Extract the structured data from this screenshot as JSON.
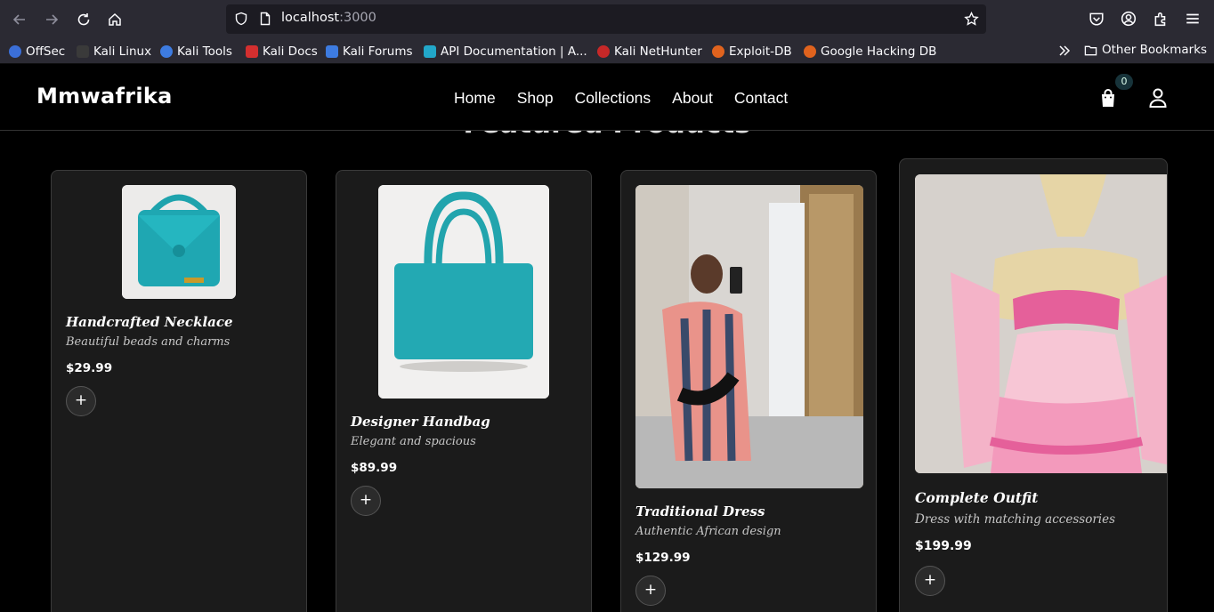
{
  "browser": {
    "url_host": "localhost",
    "url_port": ":3000",
    "bookmarks": [
      {
        "label": "OffSec",
        "color": "#3b6fd8"
      },
      {
        "label": "Kali Linux",
        "color": "#3a3a3a"
      },
      {
        "label": "Kali Tools",
        "color": "#3d7be0"
      },
      {
        "label": "Kali Docs",
        "color": "#d32f2f"
      },
      {
        "label": "Kali Forums",
        "color": "#3d7be0"
      },
      {
        "label": "API Documentation | A...",
        "color": "#22a7c9"
      },
      {
        "label": "Kali NetHunter",
        "color": "#c62828"
      },
      {
        "label": "Exploit-DB",
        "color": "#e0631e"
      },
      {
        "label": "Google Hacking DB",
        "color": "#e0631e"
      }
    ],
    "other_bookmarks": "Other Bookmarks"
  },
  "site": {
    "logo": "Mmwafrika",
    "nav": [
      "Home",
      "Shop",
      "Collections",
      "About",
      "Contact"
    ],
    "cart_count": "0",
    "section_title": "Featured Products"
  },
  "products": [
    {
      "name": "Handcrafted Necklace",
      "description": "Beautiful beads and charms",
      "price": "$29.99",
      "add_label": "+",
      "image": "turquoise-crochet-bag-small"
    },
    {
      "name": "Designer Handbag",
      "description": "Elegant and spacious",
      "price": "$89.99",
      "add_label": "+",
      "image": "turquoise-crochet-handbag"
    },
    {
      "name": "Traditional Dress",
      "description": "Authentic African design",
      "price": "$129.99",
      "add_label": "+",
      "image": "striped-crochet-dress-mirror-selfie"
    },
    {
      "name": "Complete Outfit",
      "description": "Dress with matching accessories",
      "price": "$199.99",
      "add_label": "+",
      "image": "pink-crochet-outfit-mannequin"
    }
  ],
  "colors": {
    "background": "#000000",
    "card": "#1b1b1b",
    "chrome": "#2b2a33",
    "badge": "#17333a"
  }
}
